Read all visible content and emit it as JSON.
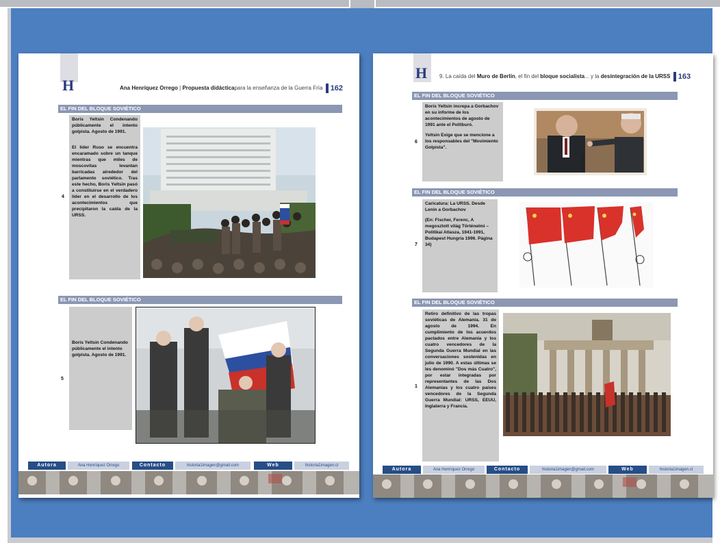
{
  "left_page": {
    "logo": "H",
    "header": {
      "author": "Ana Henríquez Orrego",
      "proposal": "Propuesta didáctica",
      "rest": "para la enseñanza de la Guerra Fría",
      "page": "162"
    },
    "sections": [
      {
        "title": "EL FIN DEL BLOQUE SOVIÉTICO",
        "number": "4",
        "paragraphs": [
          "Boris Yeltsin Condenando públicamente el intento golpista. Agosto de 1991.",
          "El líder Ruso se encuentra encaramado sobre un tanque mientras que miles de moscovitas levantan barricadas alrededor del parlamento soviético. Tras este hecho, Boris Yeltsin pasó a constituirse en el verdadero líder en el desarrollo de los acontecimientos que precipitaron la caída de la URSS."
        ]
      },
      {
        "title": "EL FIN DEL BLOQUE SOVIÉTICO",
        "number": "5",
        "paragraphs": [
          "Boris Yeltsin Condenando públicamente el intento golpista. Agosto de 1991."
        ]
      }
    ]
  },
  "right_page": {
    "logo": "H",
    "header": {
      "pre": "9. La caída del ",
      "muro": "Muro de Berlín",
      "mid1": ", el fin del ",
      "bloque": "bloque socialista",
      "mid2": "... y la ",
      "urss": "desintegración de la URSS",
      "page": "163"
    },
    "sections": [
      {
        "title": "EL FIN DEL BLOQUE SOVIÉTICO",
        "number": "6",
        "paragraphs": [
          "Boris Yeltsin increpa a Gorbachov en su informe de los acontecimientos de agosto de 1991 ante el Politburó.",
          "Yeltsin Exige que se mencione a los responsables del \"Movimiento Golpista\"."
        ]
      },
      {
        "title": "EL FIN DEL BLOQUE SOVIÉTICO",
        "number": "7",
        "paragraphs": [
          "Caricatura: La URSS. Desde Lenin a Gorbachov",
          "(En: Fischer, Ferenc, A megosztott világ Történelmi – Politikai Atlasza, 1941-1991, Budapest Hungría 1996. Página 34)"
        ]
      },
      {
        "title": "EL FIN DEL BLOQUE SOVIÉTICO",
        "number": "1",
        "paragraphs": [
          "Retiro definitivo de las tropas soviéticas de Alemania. 31 de agosto de 1994. En cumplimiento de los acuerdos pactados entre Alemania y los cuatro vencedores de la Segunda Guerra Mundial en las conversaciones sostenidas en julio de 1990. A estas últimas se les denominó \"Dos más Cuatro\", por estar integradas por representantes de las Dos Alemanias y los cuatro países vencedores de la Segunda Guerra Mundial: URSS, EEUU, Inglaterra y Francia."
        ]
      }
    ]
  },
  "footer": {
    "autora_label": "Autora",
    "autora_value": "Ana Henríquez Orrego",
    "contacto_label": "Contacto",
    "contacto_value": "historia1imagen@gmail.com",
    "web_label": "Web",
    "web_value": "historia1imagen.cl"
  },
  "colors": {
    "background": "#4c7fc0",
    "section_bar": "#8b97b3",
    "footer_dark": "#264e87",
    "text_box": "#cccccc",
    "logo": "#2a3a7e"
  }
}
